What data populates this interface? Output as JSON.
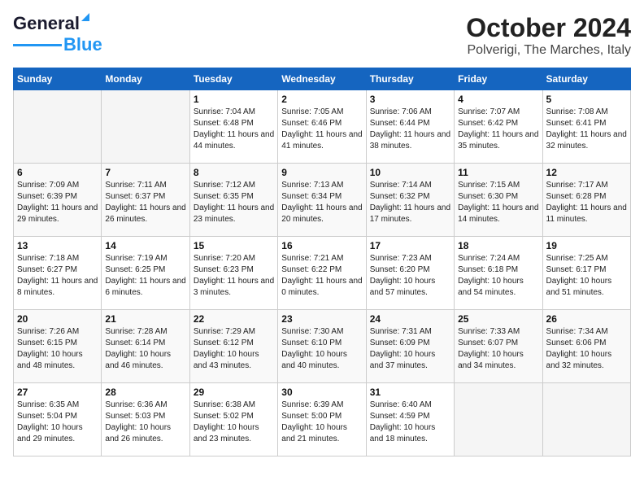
{
  "logo": {
    "line1": "General",
    "line2": "Blue"
  },
  "title": "October 2024",
  "subtitle": "Polverigi, The Marches, Italy",
  "weekdays": [
    "Sunday",
    "Monday",
    "Tuesday",
    "Wednesday",
    "Thursday",
    "Friday",
    "Saturday"
  ],
  "weeks": [
    [
      {
        "day": "",
        "sunrise": "",
        "sunset": "",
        "daylight": ""
      },
      {
        "day": "",
        "sunrise": "",
        "sunset": "",
        "daylight": ""
      },
      {
        "day": "1",
        "sunrise": "Sunrise: 7:04 AM",
        "sunset": "Sunset: 6:48 PM",
        "daylight": "Daylight: 11 hours and 44 minutes."
      },
      {
        "day": "2",
        "sunrise": "Sunrise: 7:05 AM",
        "sunset": "Sunset: 6:46 PM",
        "daylight": "Daylight: 11 hours and 41 minutes."
      },
      {
        "day": "3",
        "sunrise": "Sunrise: 7:06 AM",
        "sunset": "Sunset: 6:44 PM",
        "daylight": "Daylight: 11 hours and 38 minutes."
      },
      {
        "day": "4",
        "sunrise": "Sunrise: 7:07 AM",
        "sunset": "Sunset: 6:42 PM",
        "daylight": "Daylight: 11 hours and 35 minutes."
      },
      {
        "day": "5",
        "sunrise": "Sunrise: 7:08 AM",
        "sunset": "Sunset: 6:41 PM",
        "daylight": "Daylight: 11 hours and 32 minutes."
      }
    ],
    [
      {
        "day": "6",
        "sunrise": "Sunrise: 7:09 AM",
        "sunset": "Sunset: 6:39 PM",
        "daylight": "Daylight: 11 hours and 29 minutes."
      },
      {
        "day": "7",
        "sunrise": "Sunrise: 7:11 AM",
        "sunset": "Sunset: 6:37 PM",
        "daylight": "Daylight: 11 hours and 26 minutes."
      },
      {
        "day": "8",
        "sunrise": "Sunrise: 7:12 AM",
        "sunset": "Sunset: 6:35 PM",
        "daylight": "Daylight: 11 hours and 23 minutes."
      },
      {
        "day": "9",
        "sunrise": "Sunrise: 7:13 AM",
        "sunset": "Sunset: 6:34 PM",
        "daylight": "Daylight: 11 hours and 20 minutes."
      },
      {
        "day": "10",
        "sunrise": "Sunrise: 7:14 AM",
        "sunset": "Sunset: 6:32 PM",
        "daylight": "Daylight: 11 hours and 17 minutes."
      },
      {
        "day": "11",
        "sunrise": "Sunrise: 7:15 AM",
        "sunset": "Sunset: 6:30 PM",
        "daylight": "Daylight: 11 hours and 14 minutes."
      },
      {
        "day": "12",
        "sunrise": "Sunrise: 7:17 AM",
        "sunset": "Sunset: 6:28 PM",
        "daylight": "Daylight: 11 hours and 11 minutes."
      }
    ],
    [
      {
        "day": "13",
        "sunrise": "Sunrise: 7:18 AM",
        "sunset": "Sunset: 6:27 PM",
        "daylight": "Daylight: 11 hours and 8 minutes."
      },
      {
        "day": "14",
        "sunrise": "Sunrise: 7:19 AM",
        "sunset": "Sunset: 6:25 PM",
        "daylight": "Daylight: 11 hours and 6 minutes."
      },
      {
        "day": "15",
        "sunrise": "Sunrise: 7:20 AM",
        "sunset": "Sunset: 6:23 PM",
        "daylight": "Daylight: 11 hours and 3 minutes."
      },
      {
        "day": "16",
        "sunrise": "Sunrise: 7:21 AM",
        "sunset": "Sunset: 6:22 PM",
        "daylight": "Daylight: 11 hours and 0 minutes."
      },
      {
        "day": "17",
        "sunrise": "Sunrise: 7:23 AM",
        "sunset": "Sunset: 6:20 PM",
        "daylight": "Daylight: 10 hours and 57 minutes."
      },
      {
        "day": "18",
        "sunrise": "Sunrise: 7:24 AM",
        "sunset": "Sunset: 6:18 PM",
        "daylight": "Daylight: 10 hours and 54 minutes."
      },
      {
        "day": "19",
        "sunrise": "Sunrise: 7:25 AM",
        "sunset": "Sunset: 6:17 PM",
        "daylight": "Daylight: 10 hours and 51 minutes."
      }
    ],
    [
      {
        "day": "20",
        "sunrise": "Sunrise: 7:26 AM",
        "sunset": "Sunset: 6:15 PM",
        "daylight": "Daylight: 10 hours and 48 minutes."
      },
      {
        "day": "21",
        "sunrise": "Sunrise: 7:28 AM",
        "sunset": "Sunset: 6:14 PM",
        "daylight": "Daylight: 10 hours and 46 minutes."
      },
      {
        "day": "22",
        "sunrise": "Sunrise: 7:29 AM",
        "sunset": "Sunset: 6:12 PM",
        "daylight": "Daylight: 10 hours and 43 minutes."
      },
      {
        "day": "23",
        "sunrise": "Sunrise: 7:30 AM",
        "sunset": "Sunset: 6:10 PM",
        "daylight": "Daylight: 10 hours and 40 minutes."
      },
      {
        "day": "24",
        "sunrise": "Sunrise: 7:31 AM",
        "sunset": "Sunset: 6:09 PM",
        "daylight": "Daylight: 10 hours and 37 minutes."
      },
      {
        "day": "25",
        "sunrise": "Sunrise: 7:33 AM",
        "sunset": "Sunset: 6:07 PM",
        "daylight": "Daylight: 10 hours and 34 minutes."
      },
      {
        "day": "26",
        "sunrise": "Sunrise: 7:34 AM",
        "sunset": "Sunset: 6:06 PM",
        "daylight": "Daylight: 10 hours and 32 minutes."
      }
    ],
    [
      {
        "day": "27",
        "sunrise": "Sunrise: 6:35 AM",
        "sunset": "Sunset: 5:04 PM",
        "daylight": "Daylight: 10 hours and 29 minutes."
      },
      {
        "day": "28",
        "sunrise": "Sunrise: 6:36 AM",
        "sunset": "Sunset: 5:03 PM",
        "daylight": "Daylight: 10 hours and 26 minutes."
      },
      {
        "day": "29",
        "sunrise": "Sunrise: 6:38 AM",
        "sunset": "Sunset: 5:02 PM",
        "daylight": "Daylight: 10 hours and 23 minutes."
      },
      {
        "day": "30",
        "sunrise": "Sunrise: 6:39 AM",
        "sunset": "Sunset: 5:00 PM",
        "daylight": "Daylight: 10 hours and 21 minutes."
      },
      {
        "day": "31",
        "sunrise": "Sunrise: 6:40 AM",
        "sunset": "Sunset: 4:59 PM",
        "daylight": "Daylight: 10 hours and 18 minutes."
      },
      {
        "day": "",
        "sunrise": "",
        "sunset": "",
        "daylight": ""
      },
      {
        "day": "",
        "sunrise": "",
        "sunset": "",
        "daylight": ""
      }
    ]
  ]
}
